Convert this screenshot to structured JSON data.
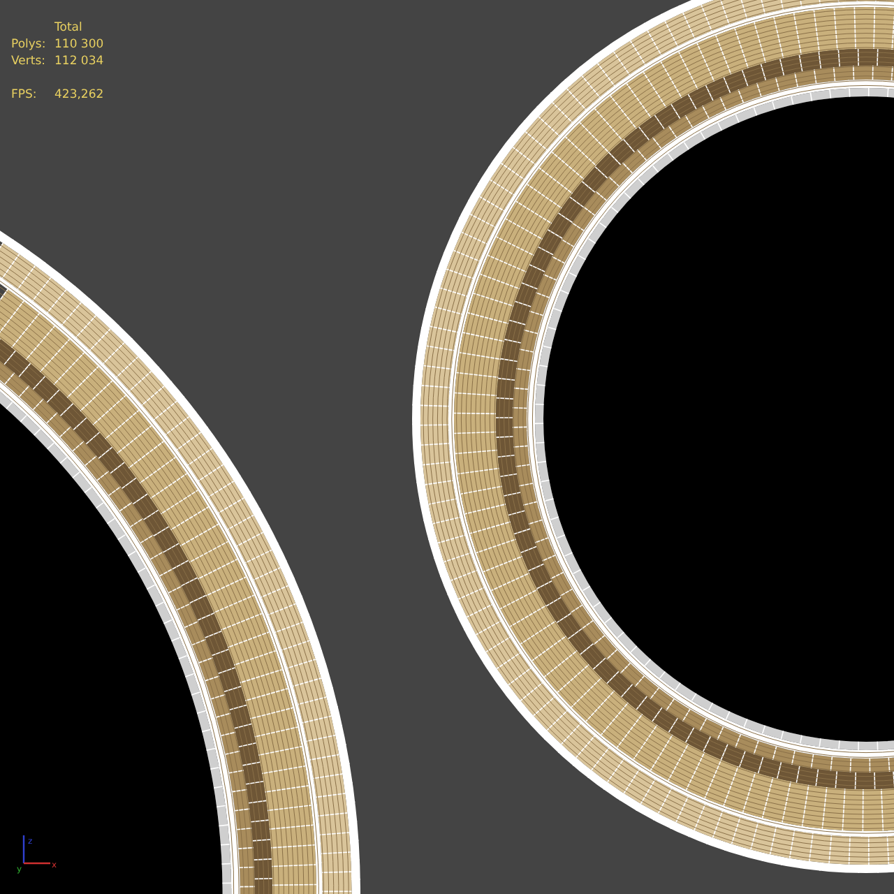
{
  "viewport": {
    "stats": {
      "header": "Total",
      "rows": [
        {
          "label": "Polys:",
          "value": "110 300"
        },
        {
          "label": "Verts:",
          "value": "112 034"
        }
      ],
      "fps": {
        "label": "FPS:",
        "value": "423,262"
      }
    },
    "axis_gizmo": {
      "labels": [
        "z",
        "y",
        "x"
      ]
    }
  }
}
